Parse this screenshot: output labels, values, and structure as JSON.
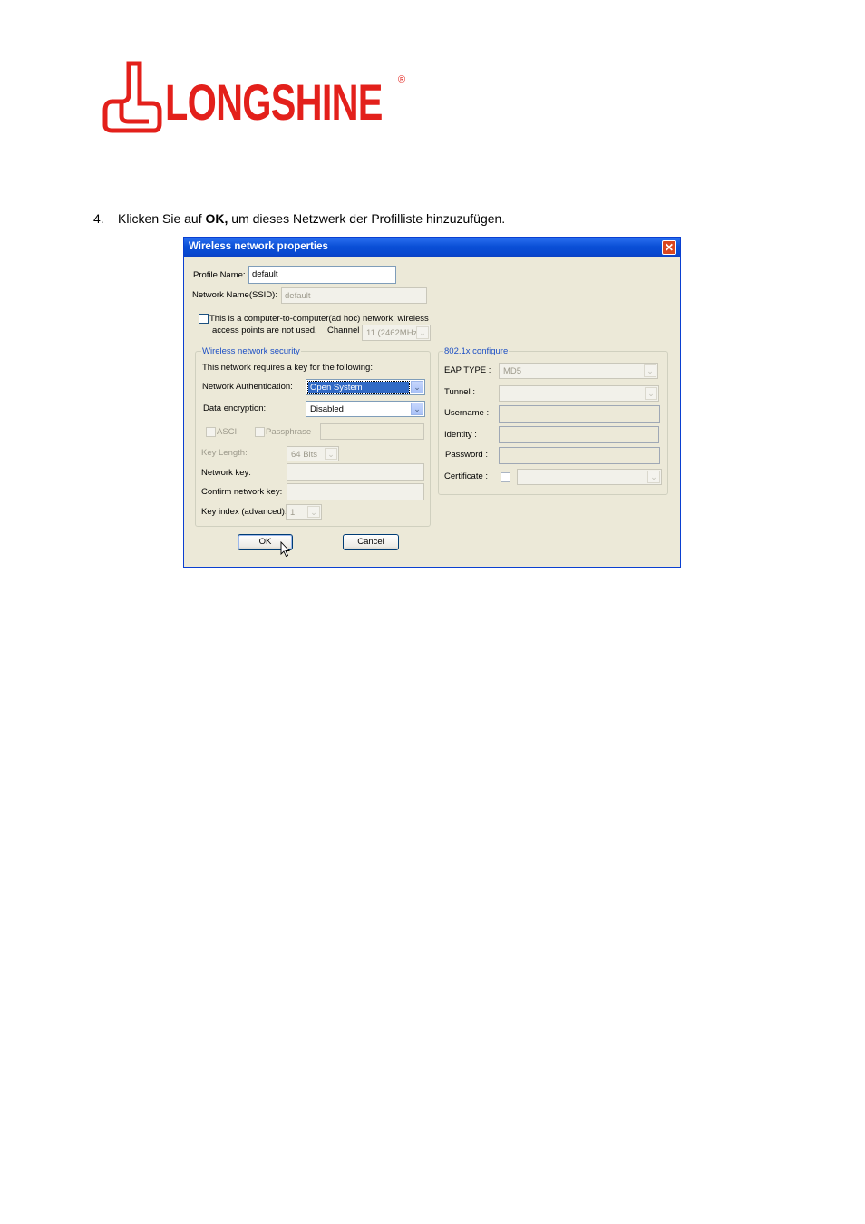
{
  "logo": {
    "text": "LONGSHINE",
    "registered": "®"
  },
  "instruction": {
    "number": "4.",
    "before": "Klicken Sie auf ",
    "bold": "OK,",
    "after": " um dieses Netzwerk der Profilliste hinzuzufügen."
  },
  "dialog": {
    "title": "Wireless network properties",
    "close_glyph": "✕",
    "profile_name_label": "Profile Name:",
    "profile_name_value": "default",
    "ssid_label": "Network Name(SSID):",
    "ssid_value": "default",
    "adhoc_text_line1": "This is a computer-to-computer(ad hoc) network; wireless",
    "adhoc_text_line2": "access points are not used.",
    "channel_label": "Channel",
    "channel_value": "11 (2462MHz)",
    "security": {
      "legend": "Wireless network security",
      "intro": "This network requires a key for the following:",
      "auth_label": "Network Authentication:",
      "auth_value": "Open System",
      "enc_label": "Data encryption:",
      "enc_value": "Disabled",
      "ascii_label": "ASCII",
      "passphrase_label": "Passphrase",
      "key_length_label": "Key Length:",
      "key_length_value": "64 Bits",
      "network_key_label": "Network key:",
      "confirm_key_label": "Confirm network key:",
      "key_index_label": "Key index (advanced):",
      "key_index_value": "1"
    },
    "dot1x": {
      "legend": "802.1x configure",
      "eap_label": "EAP TYPE :",
      "eap_value": "MD5",
      "tunnel_label": "Tunnel :",
      "username_label": "Username :",
      "identity_label": "Identity :",
      "password_label": "Password :",
      "certificate_label": "Certificate :"
    },
    "ok_label": "OK",
    "cancel_label": "Cancel"
  },
  "colors": {
    "logo_red": "#e3201b",
    "titlebar_blue": "#0a4fd6",
    "dialog_bg": "#ece9d8",
    "legend_blue": "#1c4fc4"
  }
}
